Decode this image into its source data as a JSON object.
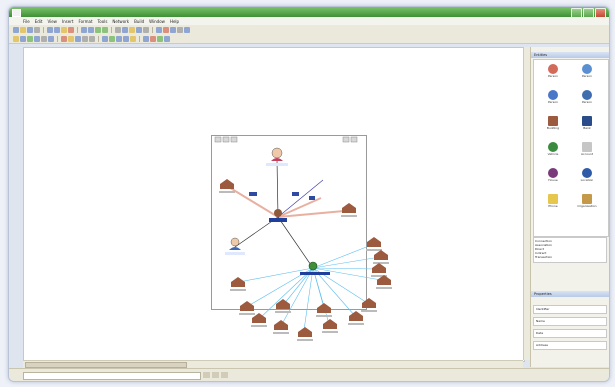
{
  "window": {
    "title": ""
  },
  "menu": {
    "items": [
      "File",
      "Edit",
      "View",
      "Insert",
      "Format",
      "Tools",
      "Network",
      "Build",
      "Window",
      "Help"
    ]
  },
  "palette": {
    "header": "Entities",
    "shapes": [
      "Person",
      "Person",
      "Person",
      "Person",
      "Building",
      "Bank",
      "Vehicle",
      "Account",
      "House",
      "Location",
      "Phone",
      "Organisation"
    ]
  },
  "legend": {
    "lines": [
      "Connection",
      "Association",
      "Direct",
      "Indirect",
      "Transaction"
    ]
  },
  "properties": {
    "header": "Properties",
    "rows": [
      "Identifier",
      "Name",
      "Date",
      "Address"
    ]
  },
  "graph": {
    "center_label": "",
    "people": [
      {
        "label": ""
      },
      {
        "label": ""
      }
    ],
    "hub_label": "",
    "houses": [
      {
        "label": ""
      },
      {
        "label": ""
      }
    ]
  }
}
